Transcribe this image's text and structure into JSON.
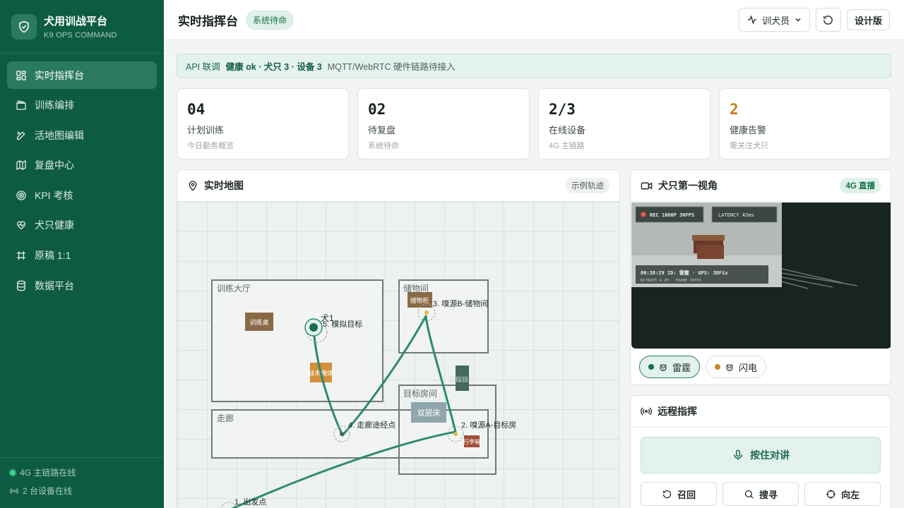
{
  "brand": {
    "title": "犬用训战平台",
    "subtitle": "K9 OPS COMMAND"
  },
  "nav": {
    "items": [
      {
        "label": "实时指挥台",
        "icon": "dashboard-icon",
        "active": true
      },
      {
        "label": "训练编排",
        "icon": "clapperboard-icon"
      },
      {
        "label": "活地图编辑",
        "icon": "pen-ruler-icon"
      },
      {
        "label": "复盘中心",
        "icon": "map-icon"
      },
      {
        "label": "KPI 考核",
        "icon": "target-icon"
      },
      {
        "label": "犬只健康",
        "icon": "heart-pulse-icon"
      },
      {
        "label": "原稿 1:1",
        "icon": "frame-icon"
      },
      {
        "label": "数据平台",
        "icon": "database-icon"
      }
    ]
  },
  "sidebar_footer": {
    "link_status": "4G 主链路在线",
    "device_status": "2 台设备在线"
  },
  "header": {
    "title": "实时指挥台",
    "status": "系统待命",
    "role": "训犬员",
    "design_label": "设计版"
  },
  "api_bar": {
    "prefix": "API 联调",
    "health": "健康 ok · 犬只 3 · 设备 3",
    "note": "MQTT/WebRTC 硬件链路待接入"
  },
  "stats": [
    {
      "value": "04",
      "label": "计划训练",
      "sub": "今日勤务概览",
      "warn": false
    },
    {
      "value": "02",
      "label": "待复盘",
      "sub": "系统待命",
      "warn": false
    },
    {
      "value": "2/3",
      "label": "在线设备",
      "sub": "4G 主链路",
      "warn": false
    },
    {
      "value": "2",
      "label": "健康告警",
      "sub": "需关注犬只",
      "warn": true
    }
  ],
  "map": {
    "title": "实时地图",
    "tag": "示例轨迹",
    "rooms": {
      "hall": "训练大厅",
      "storage": "储物间",
      "corridor": "走廊",
      "target_room": "目标房间"
    },
    "objects": {
      "table": "训练桌",
      "cabinet": "储物柜",
      "tactical": "战术掩体",
      "bunk": "双层床",
      "target_mock": "模拟目标",
      "luggage": "行李箱"
    },
    "dog_label": "犬1",
    "waypoints": [
      "1. 出发点",
      "2. 嗅源A-目标房",
      "3. 嗅源B-储物间",
      "4. 走廊途经点",
      "5. 模拟目标"
    ],
    "colors": {
      "track": "#2c8a6f",
      "room_border": "#6f7a76"
    }
  },
  "fpv": {
    "title": "犬只第一视角",
    "tag": "4G 直播",
    "hud_rec": "REC 1080P 30FPS",
    "hud_latency": "LATENCY 42ms",
    "hud_info": "00:38:29  ID: 雷霆 · GPS: 3DFix",
    "hud_bitrate": "BITRATE 4.2M · FRAME 30FPS",
    "dogs": [
      {
        "name": "雷霆",
        "color": "#176e52",
        "active": true
      },
      {
        "name": "闪电",
        "color": "#c68a22",
        "active": false
      }
    ]
  },
  "remote": {
    "title": "远程指挥",
    "ptt": "按住对讲",
    "commands": [
      {
        "label": "召回",
        "icon": "undo-icon"
      },
      {
        "label": "搜寻",
        "icon": "search-icon"
      },
      {
        "label": "向左",
        "icon": "crosshair-icon"
      }
    ]
  }
}
